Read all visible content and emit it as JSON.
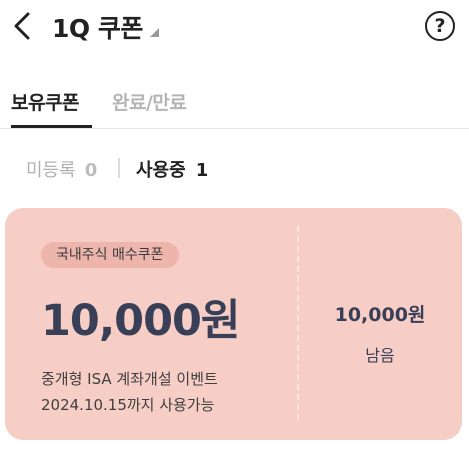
{
  "header": {
    "title": "1Q 쿠폰",
    "help_label": "?"
  },
  "tabs": [
    {
      "label": "보유쿠폰",
      "active": true
    },
    {
      "label": "완료/만료",
      "active": false
    }
  ],
  "filters": [
    {
      "label": "미등록",
      "count": "0"
    },
    {
      "label": "사용중",
      "count": "1"
    }
  ],
  "coupon": {
    "badge": "국내주식 매수쿠폰",
    "amount": "10,000원",
    "description": "중개형 ISA 계좌개설 이벤트",
    "validity": "2024.10.15까지 사용가능",
    "remaining_amount": "10,000원",
    "remaining_label": "남음"
  },
  "colors": {
    "card_bg": "#f6cec6",
    "badge_bg": "#edb5ac",
    "amount_text": "#3a3f58"
  }
}
